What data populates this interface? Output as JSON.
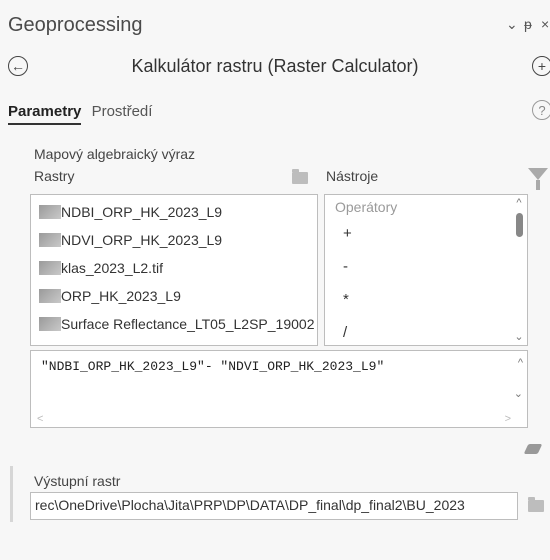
{
  "header": {
    "title": "Geoprocessing",
    "pane_controls": {
      "menu": "⌄",
      "pin": "ᵽ",
      "close": "×"
    }
  },
  "tool": {
    "back_icon": "arrow-left-icon",
    "title": "Kalkulátor rastru (Raster Calculator)",
    "add_icon": "plus-icon"
  },
  "tabs": [
    {
      "label": "Parametry",
      "active": true
    },
    {
      "label": "Prostředí",
      "active": false
    }
  ],
  "help_icon": "?",
  "map_algebra": {
    "label": "Mapový algebraický výraz",
    "rasters_label": "Rastry",
    "tools_label": "Nástroje",
    "rasters": [
      "NDBI_ORP_HK_2023_L9",
      "NDVI_ORP_HK_2023_L9",
      "klas_2023_L2.tif",
      "ORP_HK_2023_L9",
      "Surface Reflectance_LT05_L2SP_19002"
    ],
    "operators_header": "Operátory",
    "operators": [
      "+",
      "-",
      "*",
      "/"
    ],
    "expression": "\"NDBI_ORP_HK_2023_L9\"- \"NDVI_ORP_HK_2023_L9\""
  },
  "output": {
    "label": "Výstupní rastr",
    "value": "rec\\OneDrive\\Plocha\\Jita\\PRP\\DP\\DATA\\DP_final\\dp_final2\\BU_2023"
  },
  "colors": {
    "background": "#f7f7f7",
    "border": "#bdbdbd",
    "text": "#333333"
  }
}
